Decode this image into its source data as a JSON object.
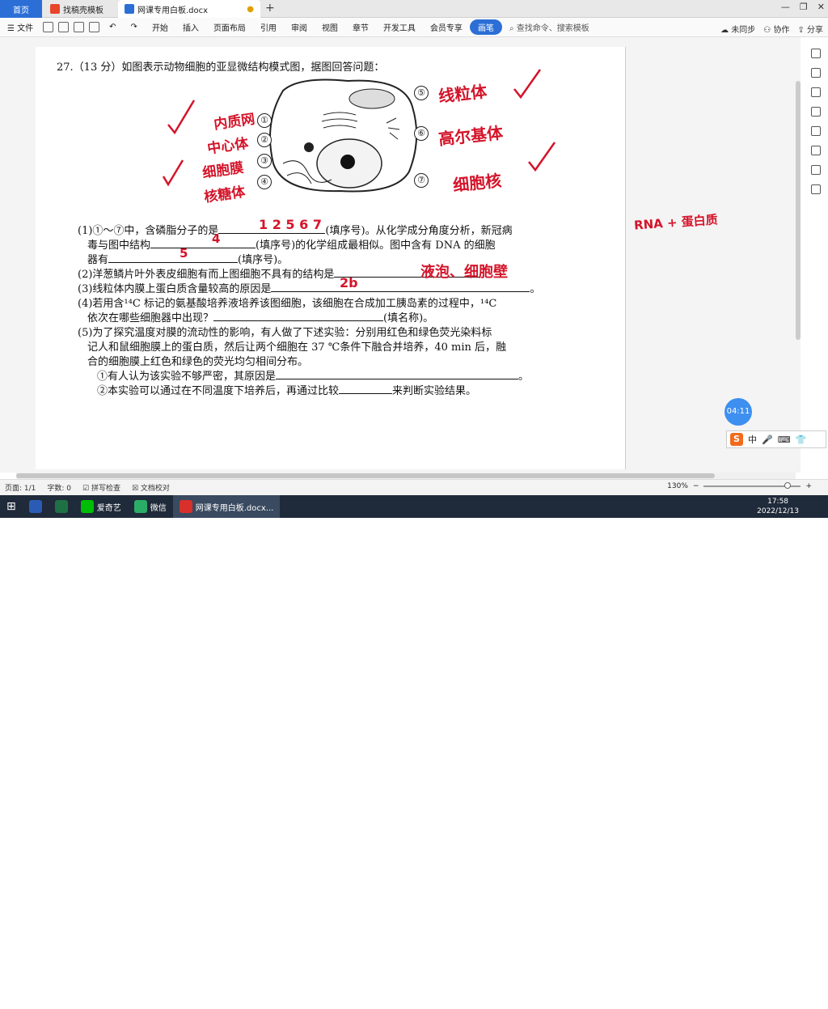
{
  "tabs": {
    "home": "首页",
    "t2": "找稿壳模板",
    "t3": "网课专用白板.docx"
  },
  "toolbar": {
    "file": "文件",
    "items": [
      "开始",
      "插入",
      "页面布局",
      "引用",
      "审阅",
      "视图",
      "章节",
      "开发工具",
      "会员专享"
    ],
    "pen": "画笔",
    "search": "查找命令、搜索模板",
    "sync": "未同步",
    "collab": "协作",
    "share": "分享"
  },
  "question": {
    "title": "27.（13 分）如图表示动物细胞的亚显微结构模式图，据图回答问题：",
    "l1": "(1)①～⑦中，含磷脂分子的是",
    "l1b": "(填序号)。从化学成分角度分析，新冠病",
    "l1c": "毒与图中结构",
    "l1d": "(填序号)的化学组成最相似。图中含有 DNA 的细胞",
    "l1e": "器有",
    "l1f": "(填序号)。",
    "l2": "(2)洋葱鳞片叶外表皮细胞有而上图细胞不具有的结构是",
    "l3": "(3)线粒体内膜上蛋白质含量较高的原因是",
    "l4": "(4)若用含¹⁴C 标记的氨基酸培养液培养该图细胞，该细胞在合成加工胰岛素的过程中，¹⁴C",
    "l4b": "依次在哪些细胞器中出现？",
    "l4c": "(填名称)。",
    "l5": "(5)为了探究温度对膜的流动性的影响，有人做了下述实验：分别用红色和绿色荧光染料标",
    "l5b": "记人和鼠细胞膜上的蛋白质，然后让两个细胞在 37 ℃条件下融合并培养，40 min 后，融",
    "l5c": "合的细胞膜上红色和绿色的荧光均匀相间分布。",
    "l5d": "①有人认为该实验不够严密，其原因是",
    "l5e": "②本实验可以通过在不同温度下培养后，再通过比较",
    "l5f": "来判断实验结果。"
  },
  "diagram_numbers": [
    "①",
    "②",
    "③",
    "④",
    "⑤",
    "⑥",
    "⑦"
  ],
  "handwriting": {
    "left1": "内质网",
    "left2": "中心体",
    "left3": "细胞膜",
    "left4": "核糖体",
    "right1": "线粒体",
    "right2": "高尔基体",
    "right3": "细胞核",
    "ans1": "1 2 5 6 7",
    "ans2": "4",
    "ans3": "5",
    "ans4": "液泡、细胞壁",
    "ans5": "2b",
    "side": "RNA + 蛋白质"
  },
  "timer": "04:11",
  "ime": {
    "lang": "中"
  },
  "status": {
    "page": "页面: 1/1",
    "words": "字数: 0",
    "spell": "拼写检查",
    "proof": "文档校对",
    "zoom": "130%"
  },
  "taskbar": {
    "app1": "爱奇艺",
    "app2": "微信",
    "app3": "网课专用白板.docx...",
    "time": "17:58",
    "date": "2022/12/13",
    "lang": "中"
  }
}
